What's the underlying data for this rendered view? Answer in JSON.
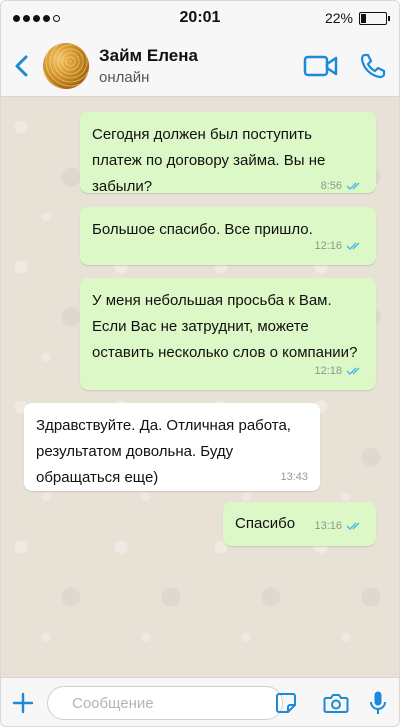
{
  "status_bar": {
    "time": "20:01",
    "battery": "22%",
    "battery_level": 0.22
  },
  "header": {
    "back_icon": "chevron-left-icon",
    "contact_name": "Займ Елена",
    "contact_status": "онлайн",
    "video_icon": "video-camera-icon",
    "call_icon": "phone-icon"
  },
  "messages": [
    {
      "direction": "outgoing",
      "lines": [
        "Сегодня должен был поступить",
        "платеж по договору займа. Вы не",
        "забыли?"
      ],
      "time": "8:56",
      "read": true
    },
    {
      "direction": "outgoing",
      "lines": [
        "Большое спасибо. Все пришло."
      ],
      "time": "12:16",
      "read": true
    },
    {
      "direction": "outgoing",
      "lines": [
        "У меня небольшая просьба к Вам.",
        "Если Вас не затруднит, можете",
        "оставить несколько слов о компании?"
      ],
      "time": "12:18",
      "read": true
    },
    {
      "direction": "incoming",
      "lines": [
        "Здравствуйте. Да. Отличная работа,",
        "результатом довольна. Буду",
        "обращаться еще)"
      ],
      "time": "13:43"
    },
    {
      "direction": "outgoing",
      "lines": [
        "Спасибо"
      ],
      "time": "13:16",
      "read": true
    }
  ],
  "input": {
    "placeholder": "Сообщение",
    "value": ""
  },
  "colors": {
    "accent": "#1a8ad9",
    "outgoing_bubble": "#dcf8c6",
    "incoming_bubble": "#ffffff",
    "read_ticks": "#4fb6ec"
  }
}
